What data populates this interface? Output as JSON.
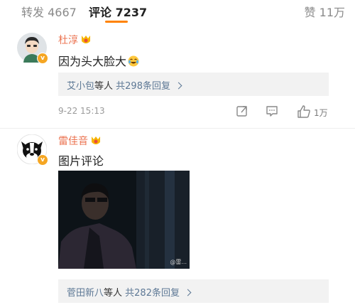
{
  "tabs": {
    "repost_label": "转发 4667",
    "comment_label": "评论 7237",
    "like_label": "赞 11万"
  },
  "comments": [
    {
      "user": "杜淳",
      "text": "因为头大脸大",
      "replies": {
        "names": "艾小包",
        "mid": "等人 ",
        "count": "共298条回复"
      },
      "time": "9-22 15:13",
      "likes": "1万"
    },
    {
      "user": "雷佳音",
      "text": "图片评论",
      "image_watermark": "@雷...",
      "replies": {
        "names": "菅田新八",
        "mid": "等人 ",
        "count": "共282条回复"
      }
    }
  ],
  "colors": {
    "accent": "#ff8200",
    "username": "#eb7350",
    "link": "#5d7895",
    "reply_bg": "#f2f2f2"
  },
  "icons": [
    "user-medal-icon",
    "verified-badge-icon",
    "laughing-emoji-icon",
    "share-icon",
    "reply-icon",
    "thumbs-up-icon",
    "chevron-right-icon"
  ]
}
